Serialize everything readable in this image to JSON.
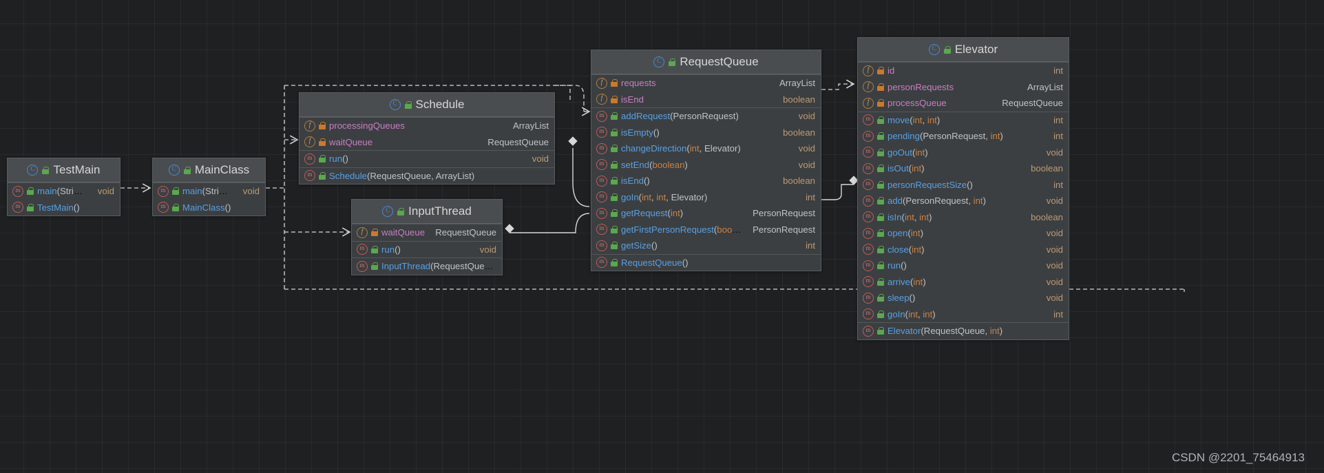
{
  "watermark": "CSDN @2201_75464913",
  "icons": {
    "class": "class-icon",
    "field": "field-icon",
    "method": "method-icon",
    "lock_public": "unlock-public-icon",
    "lock_private": "lock-private-icon"
  },
  "classes": {
    "testmain": {
      "name": "TestMain",
      "members": [
        {
          "sig": "main(String[])",
          "ret": "void",
          "kind": "method",
          "vis": "public"
        },
        {
          "sig": "TestMain()",
          "ret": "",
          "kind": "method",
          "vis": "public"
        }
      ]
    },
    "mainclass": {
      "name": "MainClass",
      "members": [
        {
          "sig": "main(String[])",
          "ret": "void",
          "kind": "method",
          "vis": "public"
        },
        {
          "sig": "MainClass()",
          "ret": "",
          "kind": "method",
          "vis": "public"
        }
      ]
    },
    "schedule": {
      "name": "Schedule",
      "fields": [
        {
          "sig": "processingQueues",
          "ret": "ArrayList<RequestQueue>",
          "kind": "field",
          "vis": "private"
        },
        {
          "sig": "waitQueue",
          "ret": "RequestQueue",
          "kind": "field",
          "vis": "private"
        }
      ],
      "methods": [
        {
          "sig": "run()",
          "ret": "void",
          "kind": "method",
          "vis": "public"
        }
      ],
      "ctors": [
        {
          "sig": "Schedule(RequestQueue, ArrayList<RequestQueue>)",
          "ret": "",
          "kind": "method",
          "vis": "public"
        }
      ]
    },
    "inputthread": {
      "name": "InputThread",
      "fields": [
        {
          "sig": "waitQueue",
          "ret": "RequestQueue",
          "kind": "field",
          "vis": "private"
        }
      ],
      "methods": [
        {
          "sig": "run()",
          "ret": "void",
          "kind": "method",
          "vis": "public"
        }
      ],
      "ctors": [
        {
          "sig": "InputThread(RequestQueue)",
          "ret": "",
          "kind": "method",
          "vis": "public"
        }
      ]
    },
    "requestqueue": {
      "name": "RequestQueue",
      "fields": [
        {
          "sig": "requests",
          "ret": "ArrayList<PersonRequest>",
          "kind": "field",
          "vis": "private"
        },
        {
          "sig": "isEnd",
          "ret": "boolean",
          "kind": "field",
          "vis": "private"
        }
      ],
      "methods": [
        {
          "sig": "addRequest(PersonRequest)",
          "ret": "void",
          "kind": "method",
          "vis": "public"
        },
        {
          "sig": "isEmpty()",
          "ret": "boolean",
          "kind": "method",
          "vis": "public"
        },
        {
          "sig": "changeDirection(int, Elevator)",
          "ret": "void",
          "kind": "method",
          "vis": "public"
        },
        {
          "sig": "setEnd(boolean)",
          "ret": "void",
          "kind": "method",
          "vis": "public"
        },
        {
          "sig": "isEnd()",
          "ret": "boolean",
          "kind": "method",
          "vis": "public"
        },
        {
          "sig": "goIn(int, int, Elevator)",
          "ret": "int",
          "kind": "method",
          "vis": "public"
        },
        {
          "sig": "getRequest(int)",
          "ret": "PersonRequest",
          "kind": "method",
          "vis": "public"
        },
        {
          "sig": "getFirstPersonRequest(boolean)",
          "ret": "PersonRequest",
          "kind": "method",
          "vis": "public"
        },
        {
          "sig": "getSize()",
          "ret": "int",
          "kind": "method",
          "vis": "public"
        }
      ],
      "ctors": [
        {
          "sig": "RequestQueue()",
          "ret": "",
          "kind": "method",
          "vis": "public"
        }
      ]
    },
    "elevator": {
      "name": "Elevator",
      "fields": [
        {
          "sig": "id",
          "ret": "int",
          "kind": "field",
          "vis": "private"
        },
        {
          "sig": "personRequests",
          "ret": "ArrayList<PersonRequest>",
          "kind": "field",
          "vis": "private"
        },
        {
          "sig": "processQueue",
          "ret": "RequestQueue",
          "kind": "field",
          "vis": "private"
        }
      ],
      "methods": [
        {
          "sig": "move(int, int)",
          "ret": "int",
          "kind": "method",
          "vis": "public"
        },
        {
          "sig": "pending(PersonRequest, int)",
          "ret": "int",
          "kind": "method",
          "vis": "public"
        },
        {
          "sig": "goOut(int)",
          "ret": "void",
          "kind": "method",
          "vis": "public"
        },
        {
          "sig": "isOut(int)",
          "ret": "boolean",
          "kind": "method",
          "vis": "public"
        },
        {
          "sig": "personRequestSize()",
          "ret": "int",
          "kind": "method",
          "vis": "public"
        },
        {
          "sig": "add(PersonRequest, int)",
          "ret": "void",
          "kind": "method",
          "vis": "public"
        },
        {
          "sig": "isIn(int, int)",
          "ret": "boolean",
          "kind": "method",
          "vis": "public"
        },
        {
          "sig": "open(int)",
          "ret": "void",
          "kind": "method",
          "vis": "public"
        },
        {
          "sig": "close(int)",
          "ret": "void",
          "kind": "method",
          "vis": "public"
        },
        {
          "sig": "run()",
          "ret": "void",
          "kind": "method",
          "vis": "public"
        },
        {
          "sig": "arrive(int)",
          "ret": "void",
          "kind": "method",
          "vis": "public"
        },
        {
          "sig": "sleep()",
          "ret": "void",
          "kind": "method",
          "vis": "public"
        },
        {
          "sig": "goIn(int, int)",
          "ret": "int",
          "kind": "method",
          "vis": "public"
        }
      ],
      "ctors": [
        {
          "sig": "Elevator(RequestQueue, int)",
          "ret": "",
          "kind": "method",
          "vis": "public"
        }
      ]
    }
  },
  "relations": [
    {
      "from": "TestMain",
      "to": "MainClass",
      "type": "dependency"
    },
    {
      "from": "MainClass",
      "to": "Schedule",
      "type": "dependency"
    },
    {
      "from": "MainClass",
      "to": "InputThread",
      "type": "dependency"
    },
    {
      "from": "MainClass",
      "to": "Elevator",
      "type": "dependency"
    },
    {
      "from": "Schedule",
      "to": "RequestQueue",
      "type": "dependency"
    },
    {
      "from": "RequestQueue",
      "to": "Schedule",
      "type": "aggregation"
    },
    {
      "from": "RequestQueue",
      "to": "InputThread",
      "type": "aggregation"
    },
    {
      "from": "RequestQueue",
      "to": "Elevator",
      "type": "aggregation"
    }
  ]
}
